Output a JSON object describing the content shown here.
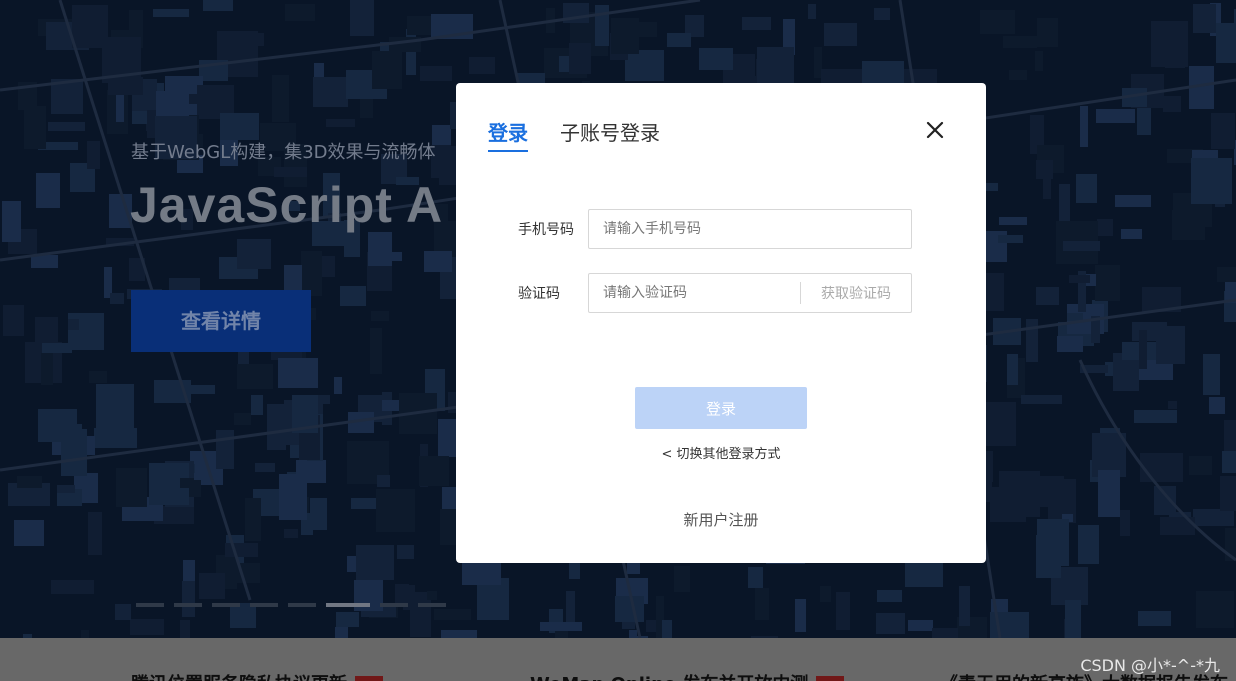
{
  "hero": {
    "tagline": "基于WebGL构建，集3D效果与流畅体",
    "headline": "JavaScript A",
    "detail_button": "查看详情",
    "dots_count": 8,
    "active_dot": 5
  },
  "news": {
    "items": [
      "腾讯位置服务隐私协议更新",
      "WeMap Online 发布并开放内测",
      "《责无用的新高族》大数据报告发布"
    ]
  },
  "watermark": "CSDN @小*-^-*九",
  "modal": {
    "tabs": [
      {
        "label": "登录",
        "active": true
      },
      {
        "label": "子账号登录",
        "active": false
      }
    ],
    "phone": {
      "label": "手机号码",
      "placeholder": "请输入手机号码",
      "value": ""
    },
    "code": {
      "label": "验证码",
      "placeholder": "请输入验证码",
      "value": "",
      "get_code_label": "获取验证码"
    },
    "login_button": "登录",
    "switch_link": "< 切换其他登录方式",
    "register_link": "新用户注册"
  },
  "colors": {
    "primary": "#1a6fdf",
    "login_button_disabled": "#bcd3f7",
    "hero_button": "#0b3a93"
  }
}
